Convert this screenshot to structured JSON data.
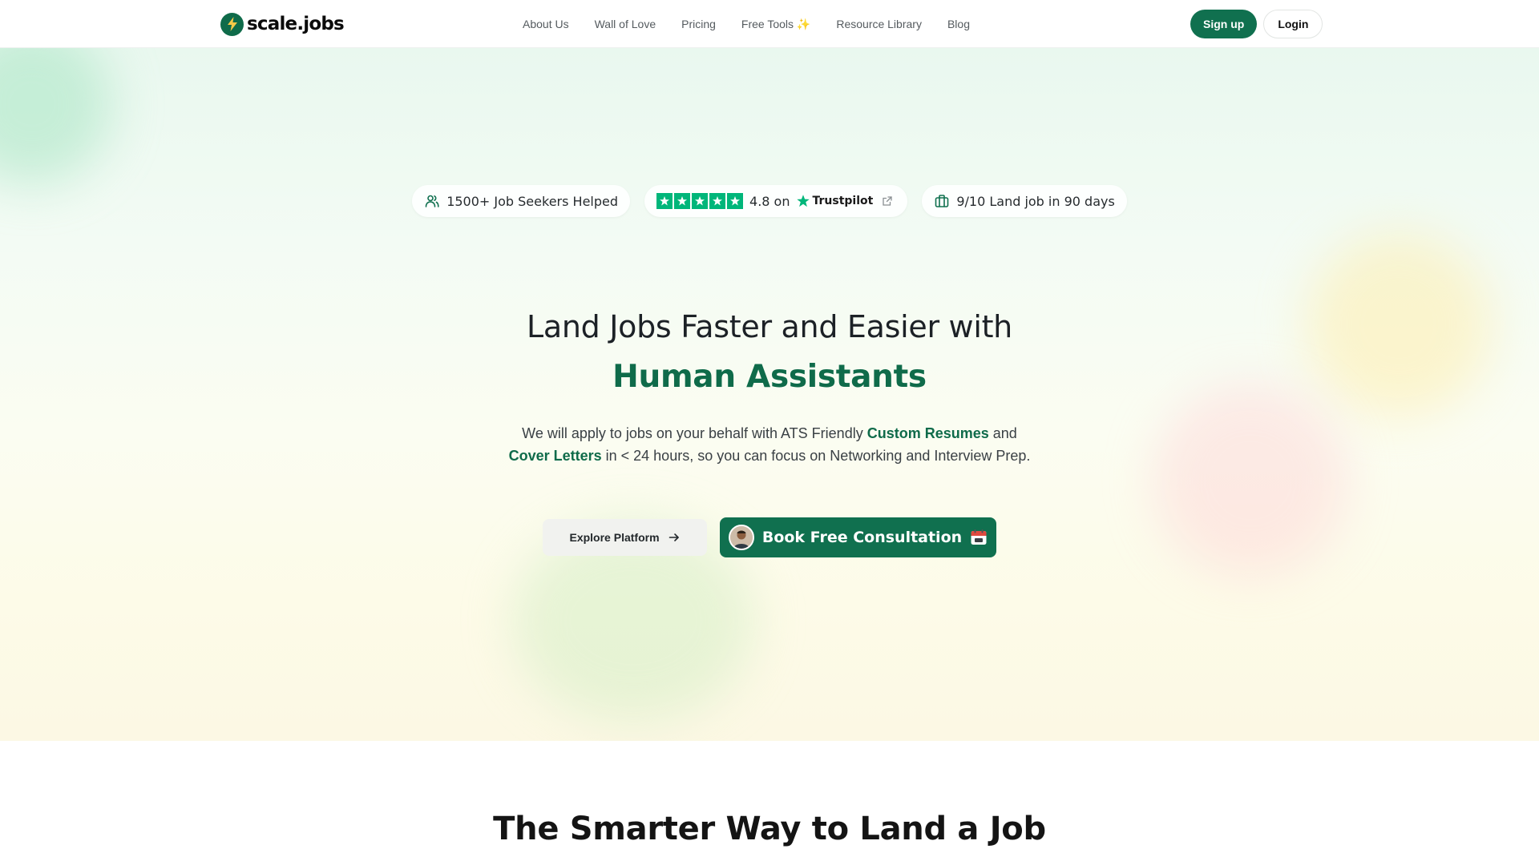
{
  "header": {
    "logo_text": "scale.jobs",
    "nav": [
      "About Us",
      "Wall of Love",
      "Pricing",
      "Free Tools ✨",
      "Resource Library",
      "Blog"
    ],
    "signup_label": "Sign up",
    "login_label": "Login"
  },
  "hero": {
    "stats": {
      "seekers": "1500+ Job Seekers Helped",
      "rating_value": "4.8 on",
      "rating_brand": "Trustpilot",
      "land_rate": "9/10 Land job in 90 days"
    },
    "title_line1": "Land Jobs Faster and Easier with",
    "title_line2": "Human Assistants",
    "subtitle": {
      "part1": "We will apply to jobs on your behalf with ATS Friendly ",
      "em1": "Custom Resumes",
      "part2": " and",
      "em2": "Cover Letters",
      "part3": " in < 24 hours, so you can focus on Networking and Interview Prep."
    },
    "explore_label": "Explore Platform",
    "book_label": "Book Free Consultation"
  },
  "next_section": {
    "title": "The Smarter Way to Land a Job"
  },
  "icons": {
    "logo": "lightning-bolt-icon",
    "seekers": "users-icon",
    "rating": "star-icon",
    "external": "external-link-icon",
    "land_rate": "briefcase-icon",
    "explore": "arrow-right-icon",
    "calendar": "calendar-icon"
  },
  "colors": {
    "brand": "#10704f",
    "accent_text": "#0f6b4a",
    "trustpilot": "#00b67a"
  }
}
